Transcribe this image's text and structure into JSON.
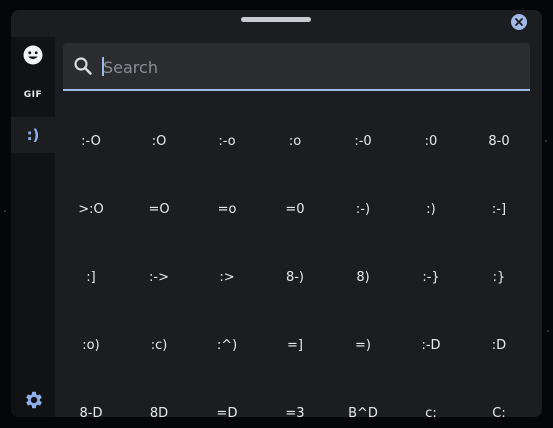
{
  "search": {
    "placeholder": "Search",
    "value": ""
  },
  "sidebar": {
    "items": [
      {
        "icon": "smiley-icon",
        "label": ""
      },
      {
        "icon": "gif-icon",
        "label": "GIF"
      },
      {
        "icon": "emoticon-icon",
        "label": ":)"
      }
    ],
    "active": 2
  },
  "emoticons": [
    ":-O",
    ":O",
    ":-o",
    ":o",
    ":-0",
    ":0",
    "8-0",
    ">:O",
    "=O",
    "=o",
    "=0",
    ":-)",
    ":)",
    ":-]",
    ":]",
    ":->",
    ":>",
    "8-)",
    "8)",
    ":-}",
    ":}",
    ":o)",
    ":c)",
    ":^)",
    "=]",
    "=)",
    ":-D",
    ":D",
    "8-D",
    "8D",
    "=D",
    "=3",
    "B^D",
    "c:",
    "C:"
  ],
  "colors": {
    "accent": "#9fb8e6",
    "panel": "#1b1d20",
    "sidebar": "#111214"
  }
}
